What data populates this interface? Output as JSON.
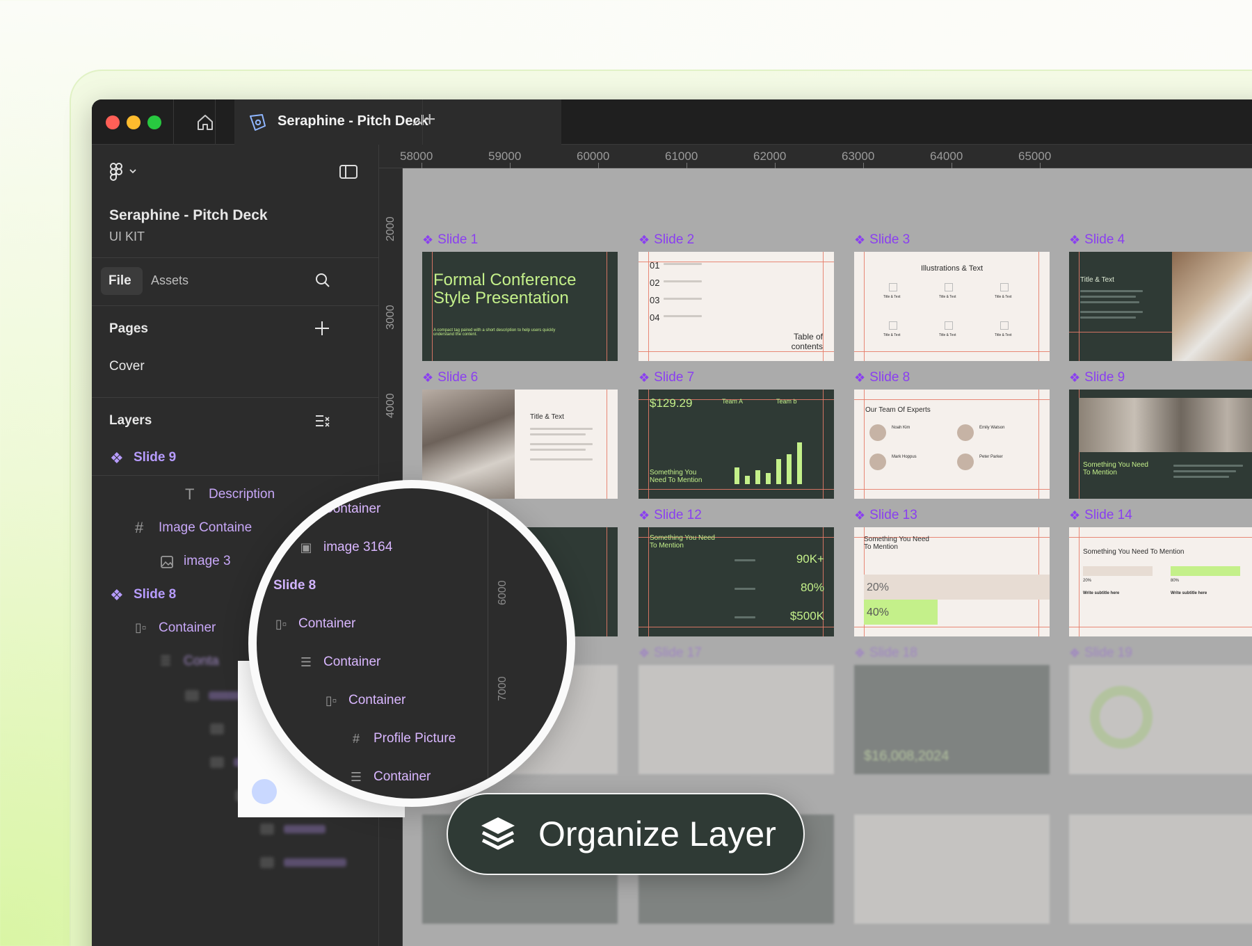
{
  "window": {
    "tab_title": "Seraphine - Pitch Deck",
    "new_tab_glyph": "+",
    "traffic_lights": [
      "#ff5f57",
      "#febc2e",
      "#28c840"
    ]
  },
  "sidebar": {
    "project_title": "Seraphine - Pitch Deck",
    "project_subtitle": "UI KIT",
    "tabs": {
      "file": "File",
      "assets": "Assets"
    },
    "pages_heading": "Pages",
    "pages": [
      "Cover"
    ],
    "layers_heading": "Layers",
    "layers": [
      {
        "label": "Slide 9",
        "icon": "component-icon"
      },
      {
        "label": "Description",
        "icon": "text-icon"
      },
      {
        "label": "Image Containe",
        "icon": "frame-icon"
      },
      {
        "label": "image 3",
        "icon": "image-icon"
      },
      {
        "label": "Slide 8",
        "icon": "component-icon"
      },
      {
        "label": "Container",
        "icon": "hstack-icon"
      },
      {
        "label": "Conta",
        "icon": "vstack-icon"
      }
    ]
  },
  "ruler": {
    "x_labels": [
      "58000",
      "59000",
      "60000",
      "61000",
      "62000",
      "63000",
      "64000",
      "65000"
    ],
    "y_labels": [
      "2000",
      "3000",
      "4000",
      "6000",
      "7000"
    ]
  },
  "slides": {
    "labels": [
      "Slide 1",
      "Slide 2",
      "Slide 3",
      "Slide 4",
      "Slide 6",
      "Slide 7",
      "Slide 8",
      "Slide 9",
      "Slide 12",
      "Slide 13",
      "Slide 14",
      "Slide 17",
      "Slide 18",
      "Slide 19"
    ],
    "slide1": {
      "title": "Formal Conference Style Presentation",
      "body": "A compact tag paired with a short description to help users quickly understand the content."
    },
    "slide2": {
      "numbers": [
        "01",
        "02",
        "03",
        "04"
      ],
      "caption": "Table of contents"
    },
    "slide3": {
      "title": "Illustrations & Text",
      "item": "Title & Text"
    },
    "slide4": {
      "title": "Title & Text"
    },
    "slide6": {
      "title": "Title & Text"
    },
    "slide7": {
      "price": "$129.29",
      "team_a": "Team A",
      "team_b": "Team b",
      "footer": "Something You Need To Mention"
    },
    "slide8": {
      "title": "Our Team Of Experts",
      "people": [
        "Noah Kim",
        "Emily Watson",
        "Mark Hoppus",
        "Peter Parker"
      ]
    },
    "slide9": {
      "footer": "Something You Need To Mention"
    },
    "slide12": {
      "title": "Something You Need To Mention",
      "stats": [
        "90K+",
        "80%",
        "$500K"
      ]
    },
    "slide13": {
      "title": "Something You Need To Mention",
      "stats": [
        "20%",
        "40%"
      ]
    },
    "slide14": {
      "title": "Something You Need To Mention",
      "stats": [
        "20%",
        "80%"
      ],
      "subtitle": "Write subtitle here"
    },
    "slide18": {
      "value": "$16,008,2024"
    }
  },
  "magnifier": {
    "rows": [
      {
        "label": "Container",
        "icon": "hstack-icon"
      },
      {
        "label": "image 3164",
        "icon": "image-icon"
      },
      {
        "label": "Slide 8",
        "icon": "none"
      },
      {
        "label": "Container",
        "icon": "hstack-icon"
      },
      {
        "label": "Container",
        "icon": "vstack-icon"
      },
      {
        "label": "Container",
        "icon": "hstack-icon"
      },
      {
        "label": "Profile Picture",
        "icon": "frame-icon"
      },
      {
        "label": "Container",
        "icon": "vstack-icon"
      }
    ],
    "ruler_labels": [
      "6000",
      "7000"
    ]
  },
  "badge": {
    "label": "Organize Layer",
    "icon": "layers-icon"
  },
  "colors": {
    "accent_purple": "#8a3ff0",
    "slide_dark": "#2f3a35",
    "slide_green": "#c4f08a"
  }
}
